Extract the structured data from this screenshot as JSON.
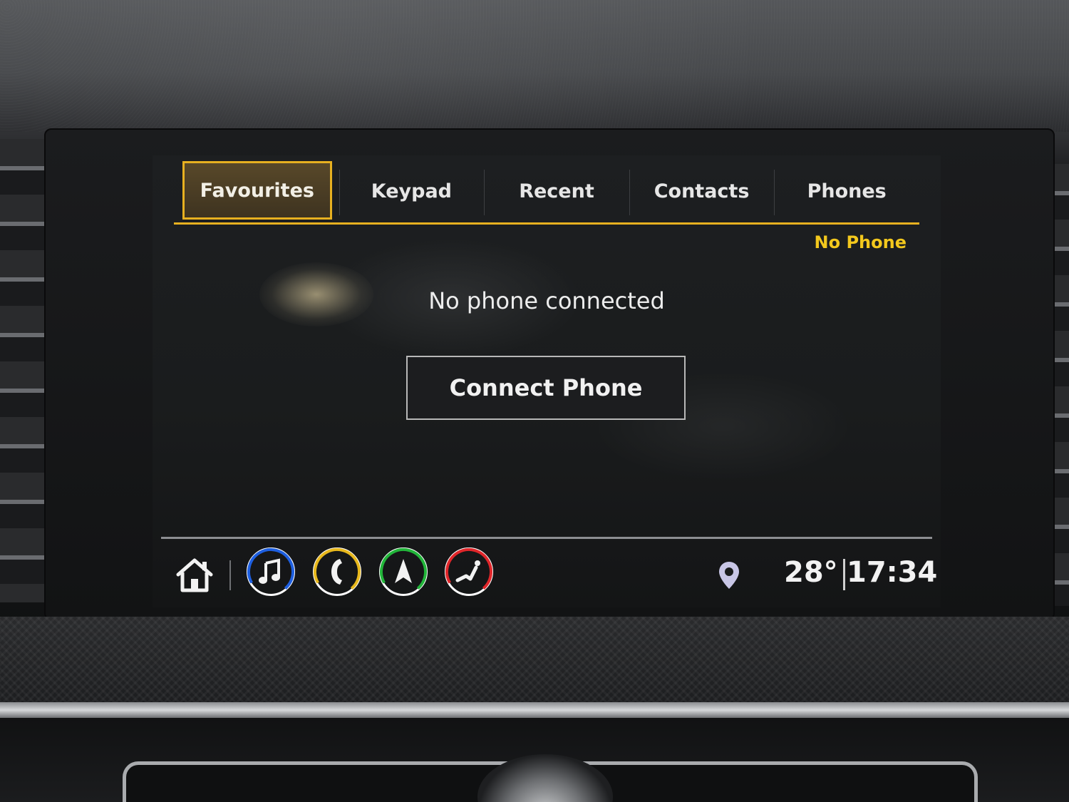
{
  "tabs": [
    {
      "label": "Favourites",
      "active": true
    },
    {
      "label": "Keypad",
      "active": false
    },
    {
      "label": "Recent",
      "active": false
    },
    {
      "label": "Contacts",
      "active": false
    },
    {
      "label": "Phones",
      "active": false
    }
  ],
  "status": {
    "phone_status": "No Phone"
  },
  "main": {
    "message": "No phone connected",
    "connect_button": "Connect Phone"
  },
  "bottom_bar": {
    "apps": [
      {
        "icon": "music-note-icon",
        "ring_color": "#1e5fe0"
      },
      {
        "icon": "phone-icon",
        "ring_color": "#e8b81c"
      },
      {
        "icon": "navigation-arrow-icon",
        "ring_color": "#22b53a"
      },
      {
        "icon": "vehicle-seat-icon",
        "ring_color": "#e0262a"
      }
    ],
    "temperature": "28°",
    "time": "17:34"
  },
  "colors": {
    "accent": "#e7b020",
    "status_yellow": "#f3c81d"
  }
}
